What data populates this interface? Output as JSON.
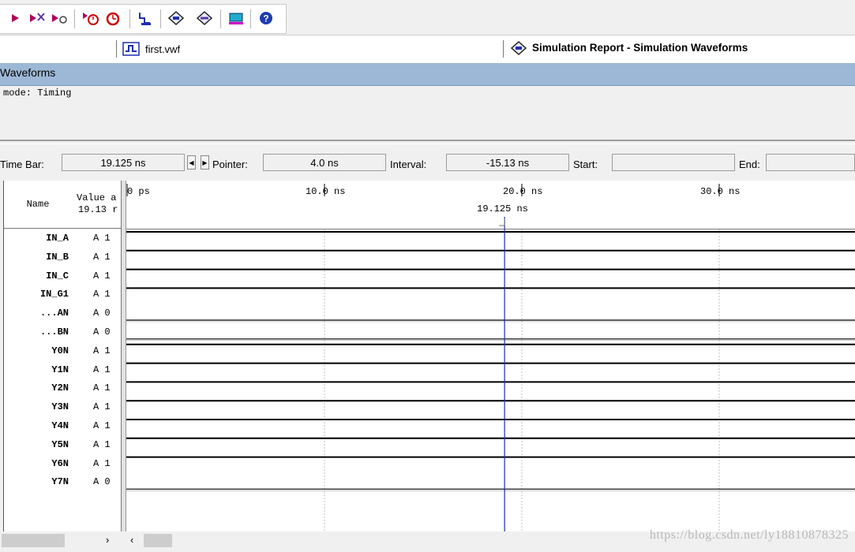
{
  "tabs": {
    "file_tab": "first.vwf",
    "report_tab": "Simulation Report - Simulation Waveforms"
  },
  "panel": {
    "title": "Waveforms",
    "mode_text": "mode: Timing"
  },
  "timebar": {
    "time_bar_label": "Time Bar:",
    "time_bar_value": "19.125 ns",
    "pointer_label": "Pointer:",
    "pointer_value": "4.0 ns",
    "interval_label": "Interval:",
    "interval_value": "-15.13 ns",
    "start_label": "Start:",
    "start_value": "",
    "end_label": "End:",
    "end_value": ""
  },
  "table": {
    "name_header": "Name",
    "value_header_line1": "Value a",
    "value_header_line2": "19.13 r"
  },
  "time_axis": {
    "ticks": [
      "0 ps",
      "10.0 ns",
      "20.0 ns",
      "30.0 ns"
    ],
    "cursor_label": "19.125 ns",
    "cursor_time_ns": 19.125,
    "tick_step_ns": 10
  },
  "signals": [
    {
      "name": "IN_A",
      "value": "A 1",
      "level": 1
    },
    {
      "name": "IN_B",
      "value": "A 1",
      "level": 1
    },
    {
      "name": "IN_C",
      "value": "A 1",
      "level": 1
    },
    {
      "name": "IN_G1",
      "value": "A 1",
      "level": 1
    },
    {
      "name": "...AN",
      "value": "A 0",
      "level": 0
    },
    {
      "name": "...BN",
      "value": "A 0",
      "level": 0
    },
    {
      "name": "Y0N",
      "value": "A 1",
      "level": 1
    },
    {
      "name": "Y1N",
      "value": "A 1",
      "level": 1
    },
    {
      "name": "Y2N",
      "value": "A 1",
      "level": 1
    },
    {
      "name": "Y3N",
      "value": "A 1",
      "level": 1
    },
    {
      "name": "Y4N",
      "value": "A 1",
      "level": 1
    },
    {
      "name": "Y5N",
      "value": "A 1",
      "level": 1
    },
    {
      "name": "Y6N",
      "value": "A 1",
      "level": 1
    },
    {
      "name": "Y7N",
      "value": "A 0",
      "level": 0
    }
  ],
  "toolbar": {
    "icons": [
      "run-icon",
      "compile-icon",
      "step-icon",
      "timing-start-icon",
      "timing-stop-icon",
      "waveform-icon",
      "report-icon",
      "settings-icon",
      "programmer-icon",
      "help-icon"
    ]
  },
  "watermark": "https://blog.csdn.net/ly18810878325",
  "colors": {
    "cursor": "#1e2fb0",
    "panel_header": "#9db8d6",
    "waveform": "#000000",
    "grid": "#bdbdbd"
  }
}
